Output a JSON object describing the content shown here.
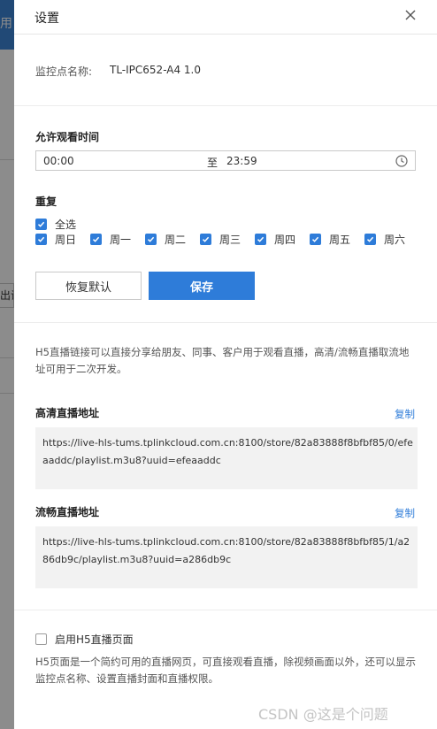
{
  "background": {
    "fragment_title": "用",
    "fragment_button": "出设"
  },
  "header": {
    "title": "设置",
    "close_icon": "close-icon"
  },
  "camera": {
    "name_label": "监控点名称:",
    "name_value": "TL-IPC652-A4 1.0"
  },
  "watch_time": {
    "label": "允许观看时间",
    "start": "00:00",
    "separator": "至",
    "end": "23:59",
    "icon": "clock-icon"
  },
  "repeat": {
    "label": "重复",
    "select_all": {
      "label": "全选",
      "checked": true
    },
    "days": [
      {
        "label": "周日",
        "checked": true
      },
      {
        "label": "周一",
        "checked": true
      },
      {
        "label": "周二",
        "checked": true
      },
      {
        "label": "周三",
        "checked": true
      },
      {
        "label": "周四",
        "checked": true
      },
      {
        "label": "周五",
        "checked": true
      },
      {
        "label": "周六",
        "checked": true
      }
    ]
  },
  "actions": {
    "reset_label": "恢复默认",
    "save_label": "保存"
  },
  "h5": {
    "description": "H5直播链接可以直接分享给朋友、同事、客户用于观看直播，高清/流畅直播取流地址可用于二次开发。",
    "hd": {
      "label": "高清直播地址",
      "copy_label": "复制",
      "url": "https://live-hls-tums.tplinkcloud.com.cn:8100/store/82a83888f8bfbf85/0/efeaaddc/playlist.m3u8?uuid=efeaaddc"
    },
    "smooth": {
      "label": "流畅直播地址",
      "copy_label": "复制",
      "url": "https://live-hls-tums.tplinkcloud.com.cn:8100/store/82a83888f8bfbf85/1/a286db9c/playlist.m3u8?uuid=a286db9c"
    },
    "enable_page": {
      "label": "启用H5直播页面",
      "checked": false
    },
    "page_description": "H5页面是一个简约可用的直播网页，可直接观看直播，除视频画面以外，还可以显示监控点名称、设置直播封面和直播权限。"
  },
  "watermark": "CSDN @这是个问题",
  "colors": {
    "accent": "#2e7cd9",
    "overlay": "#7f8080"
  }
}
